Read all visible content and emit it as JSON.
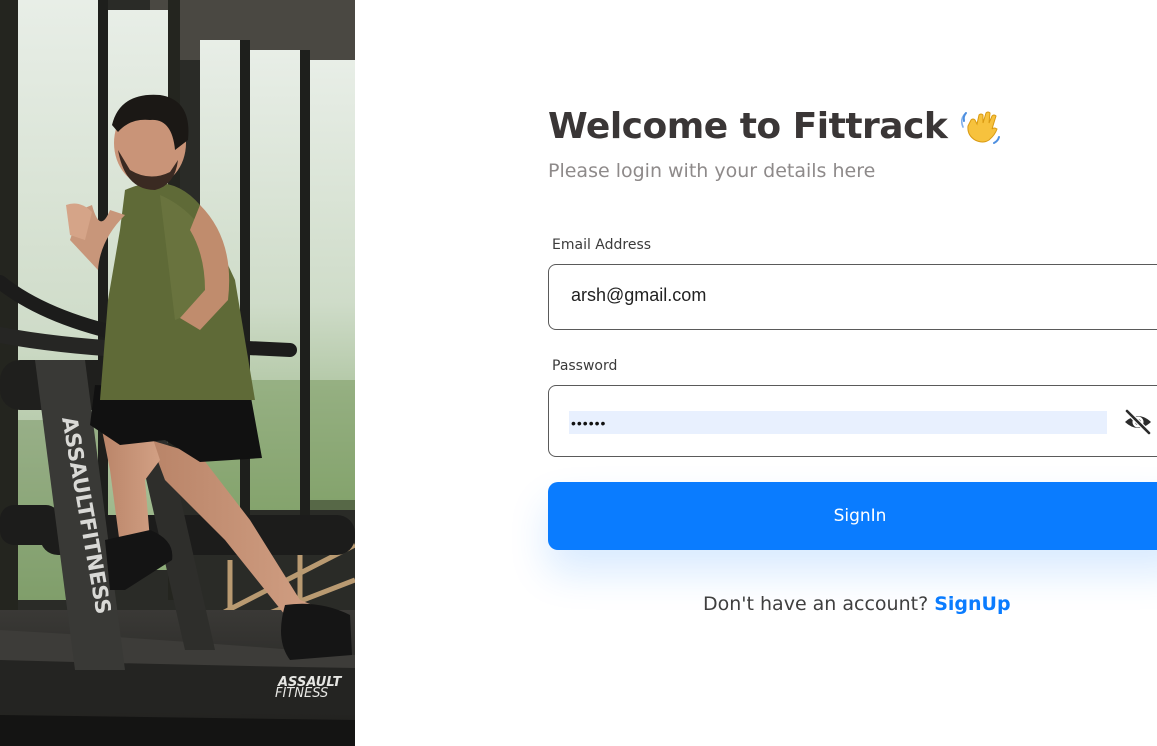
{
  "hero": {
    "image": "man-running-on-treadmill-gym-photo",
    "brand_vertical": "ASSAULTFITNESS",
    "brand_logo_line1": "ASSAULT",
    "brand_logo_line2": "FITNESS"
  },
  "login": {
    "title": "Welcome to Fittrack",
    "title_icon": "waving-hand-icon",
    "subtitle": "Please login with your details here",
    "email_label": "Email Address",
    "email_value": "arsh@gmail.com",
    "password_label": "Password",
    "password_value": "••••••",
    "password_toggle_icon": "eye-slash-icon",
    "signin_label": "SignIn",
    "signup_prompt": "Don't have an account?",
    "signup_link": "SignUp"
  },
  "colors": {
    "primary": "#0a7cff",
    "title": "#3a3636",
    "subtitle": "#8e8a8a",
    "autofill": "#e8f0fe"
  }
}
